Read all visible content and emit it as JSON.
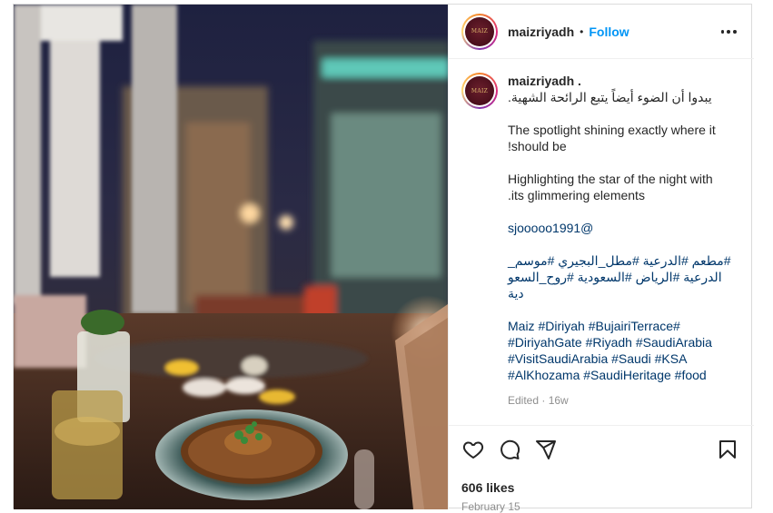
{
  "header": {
    "username": "maizriyadh",
    "separator": "•",
    "follow_label": "Follow",
    "avatar_text": "MAIZ"
  },
  "caption": {
    "username": "maizriyadh .",
    "lines": [
      "يبدوا أن الضوء أيضاً يتبع الرائحة الشهية.",
      "",
      "The spotlight shining exactly where it",
      "!should be",
      "",
      "Highlighting the star of the night with",
      ".its glimmering elements",
      "",
      "sjooooo1991@",
      "",
      "#مطعم #الدرعية #مطل_البجيري #موسم_",
      "الدرعية #الرياض #السعودية #روح_السعو",
      "دية",
      "",
      "Maiz #Diriyah #BujairiTerrace#",
      "#DiriyahGate #Riyadh #SaudiArabia",
      "#VisitSaudiArabia #Saudi #KSA",
      "#AlKhozama #SaudiHeritage #food"
    ],
    "edited": "Edited · 16w"
  },
  "actions": {
    "icons": [
      "heart-icon",
      "comment-icon",
      "share-icon",
      "bookmark-icon"
    ],
    "likes": "606 likes",
    "date": "February 15"
  },
  "colors": {
    "follow": "#0095f6",
    "link": "#00376b",
    "muted": "#8e8e8e",
    "border": "#dbdbdb"
  }
}
